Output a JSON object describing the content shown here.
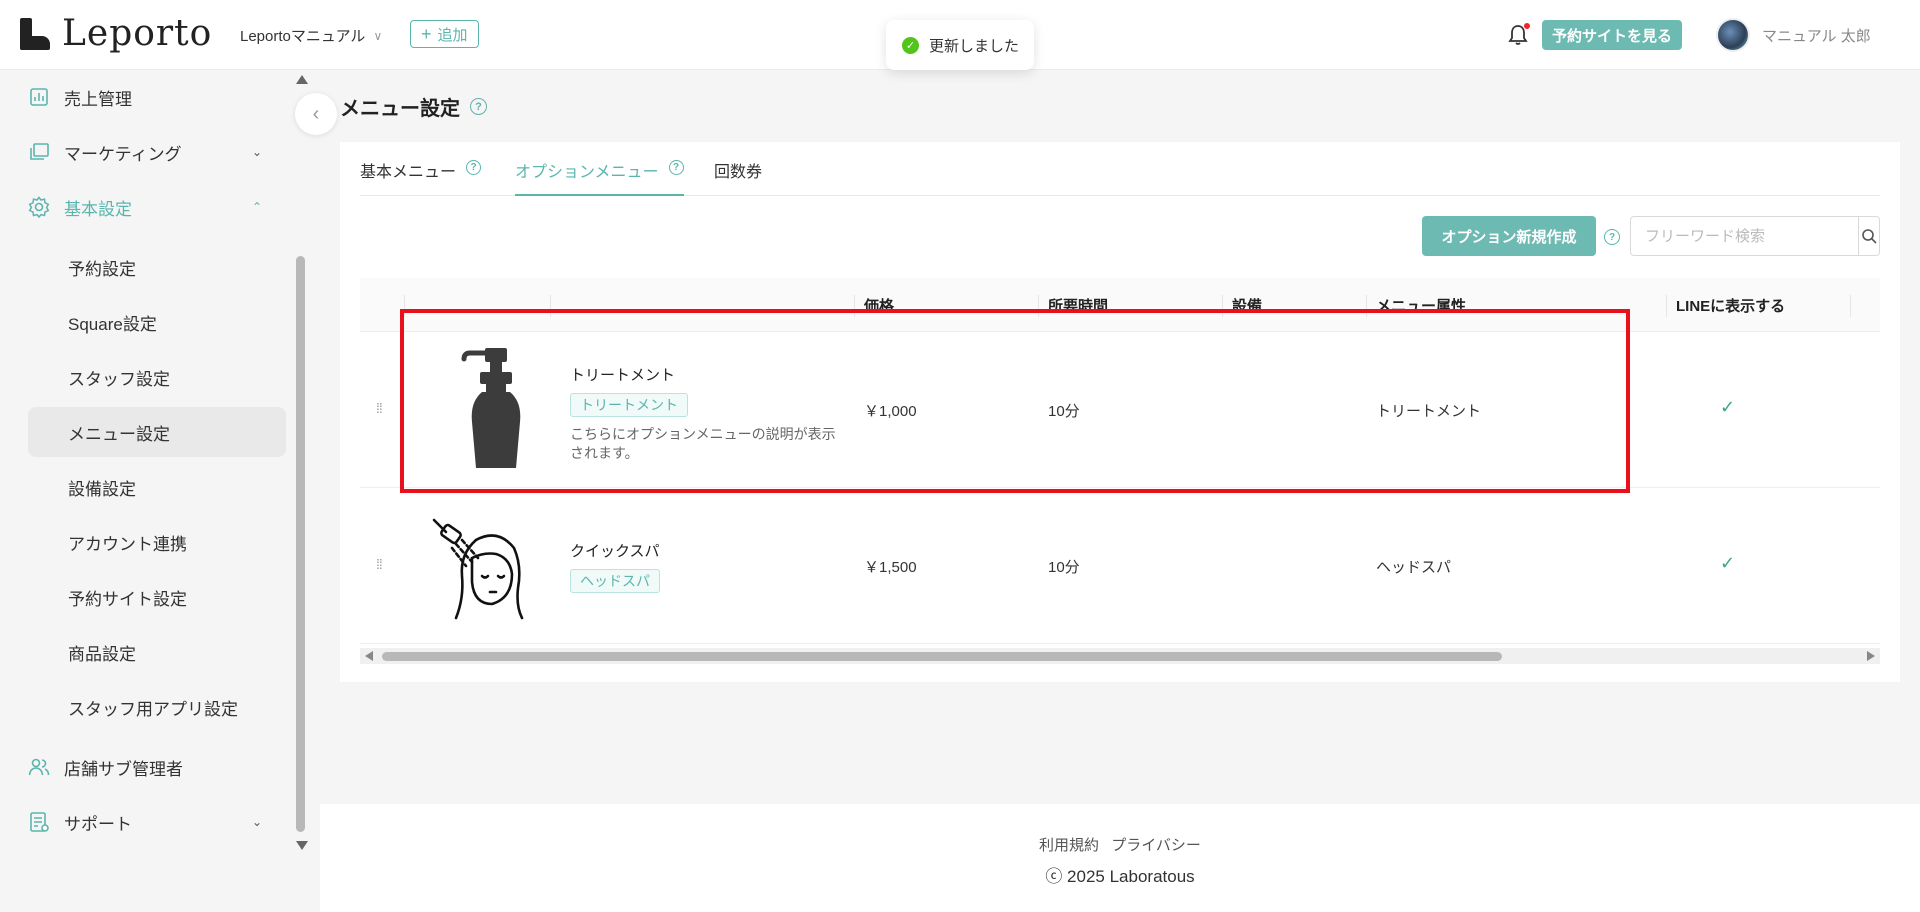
{
  "header": {
    "logo_text": "Leporto",
    "store_name": "Leportoマニュアル",
    "add_label": "追加",
    "toast_text": "更新しました",
    "site_button": "予約サイトを見る",
    "user_name": "マニュアル 太郎"
  },
  "sidebar": {
    "items": [
      {
        "label": "売上管理",
        "icon": "chart-icon"
      },
      {
        "label": "マーケティング",
        "icon": "layers-icon"
      },
      {
        "label": "基本設定",
        "icon": "gear-icon"
      },
      {
        "label": "店舗サブ管理者",
        "icon": "users-icon"
      },
      {
        "label": "サポート",
        "icon": "support-icon"
      }
    ],
    "subitems": [
      {
        "label": "予約設定"
      },
      {
        "label": "Square設定"
      },
      {
        "label": "スタッフ設定"
      },
      {
        "label": "メニュー設定"
      },
      {
        "label": "設備設定"
      },
      {
        "label": "アカウント連携"
      },
      {
        "label": "予約サイト設定"
      },
      {
        "label": "商品設定"
      },
      {
        "label": "スタッフ用アプリ設定"
      }
    ],
    "active_item": "メニュー設定"
  },
  "main": {
    "title": "メニュー設定",
    "tabs": [
      {
        "label": "基本メニュー"
      },
      {
        "label": "オプションメニュー"
      },
      {
        "label": "回数券"
      }
    ],
    "active_tab": "オプションメニュー",
    "create_button": "オプション新規作成",
    "search_placeholder": "フリーワード検索",
    "table": {
      "headers": [
        "価格",
        "所要時間",
        "設備",
        "メニュー属性",
        "LINEに表示する"
      ],
      "rows": [
        {
          "name": "トリートメント",
          "tag": "トリートメント",
          "description": "こちらにオプションメニューの説明が表示されます。",
          "price": "￥1,000",
          "duration": "10分",
          "equipment": "",
          "attribute": "トリートメント",
          "line_visible": "✓",
          "image": "pump-bottle-icon"
        },
        {
          "name": "クイックスパ",
          "tag": "ヘッドスパ",
          "description": "",
          "price": "￥1,500",
          "duration": "10分",
          "equipment": "",
          "attribute": "ヘッドスパ",
          "line_visible": "✓",
          "image": "head-spa-icon"
        }
      ]
    }
  },
  "footer": {
    "terms": "利用規約",
    "privacy": "プライバシー",
    "copyright": "ⓒ 2025 Laboratous"
  },
  "colors": {
    "accent": "#5bb5ad",
    "button": "#6cbab2",
    "highlight": "#e8101a",
    "toast_ok": "#52c41a"
  }
}
